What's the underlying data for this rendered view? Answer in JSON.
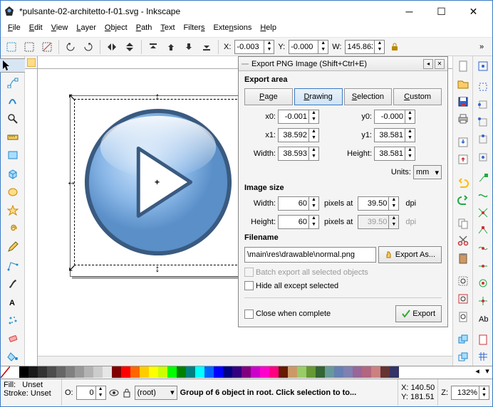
{
  "window": {
    "title": "*pulsante-02-architetto-f-01.svg - Inkscape"
  },
  "menu": {
    "file": "File",
    "edit": "Edit",
    "view": "View",
    "layer": "Layer",
    "object": "Object",
    "path": "Path",
    "text": "Text",
    "filters": "Filters",
    "extensions": "Extensions",
    "help": "Help"
  },
  "coordbar": {
    "x_label": "X:",
    "x": "-0.003",
    "y_label": "Y:",
    "y": "-0.000",
    "w_label": "W:",
    "w": "145.863"
  },
  "export": {
    "title": "Export PNG Image (Shift+Ctrl+E)",
    "area_label": "Export area",
    "tabs": {
      "page": "Page",
      "drawing": "Drawing",
      "selection": "Selection",
      "custom": "Custom"
    },
    "x0_label": "x0:",
    "x0": "-0.001",
    "y0_label": "y0:",
    "y0": "-0.000",
    "x1_label": "x1:",
    "x1": "38.592",
    "y1_label": "y1:",
    "y1": "38.581",
    "w_label": "Width:",
    "w": "38.593",
    "h_label": "Height:",
    "h": "38.581",
    "units_label": "Units:",
    "units": "mm",
    "imgsize_label": "Image size",
    "img_w_label": "Width:",
    "img_w": "60",
    "px_at": "pixels at",
    "dpi_w": "39.50",
    "dpi": "dpi",
    "img_h_label": "Height:",
    "img_h": "60",
    "dpi_h": "39.50",
    "filename_label": "Filename",
    "filename": "\\main\\res\\drawable\\normal.png",
    "export_as": "Export As...",
    "batch": "Batch export all selected objects",
    "hide": "Hide all except selected",
    "close_when": "Close when complete",
    "export_btn": "Export"
  },
  "palette": [
    "#ffffff",
    "#000000",
    "#1a1a1a",
    "#333333",
    "#4d4d4d",
    "#666666",
    "#808080",
    "#999999",
    "#b3b3b3",
    "#cccccc",
    "#e6e6e6",
    "#800000",
    "#ff0000",
    "#ff6600",
    "#ffcc00",
    "#ffff00",
    "#ccff00",
    "#00ff00",
    "#008000",
    "#008080",
    "#00ffff",
    "#0066ff",
    "#0000ff",
    "#000080",
    "#330080",
    "#800080",
    "#cc00cc",
    "#ff00cc",
    "#ff0080",
    "#661a00",
    "#cc9966",
    "#99cc66",
    "#669933",
    "#336633",
    "#669999",
    "#6680b3",
    "#8080b3",
    "#996699",
    "#b36680",
    "#cc8080",
    "#663333",
    "#333366"
  ],
  "status": {
    "fill": "Fill:",
    "fill_v": "Unset",
    "stroke": "Stroke:",
    "stroke_v": "Unset",
    "o": "O:",
    "o_v": "0",
    "layer": "(root)",
    "msg": "Group of 6 object in root. Click selection to to...",
    "x": "X:",
    "x_v": "140.50",
    "y": "Y:",
    "y_v": "181.51",
    "z": "Z:",
    "z_v": "132%"
  }
}
